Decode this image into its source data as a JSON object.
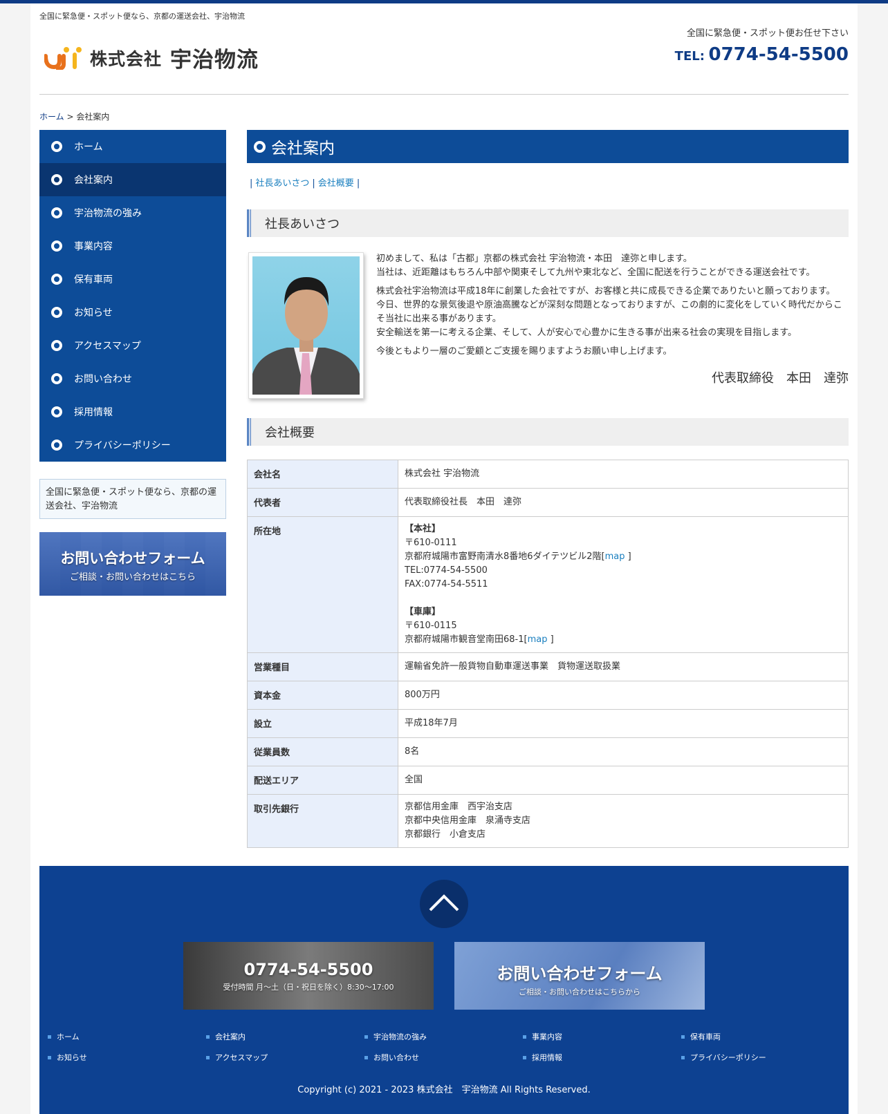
{
  "header": {
    "tagline": "全国に緊急便・スポット便なら、京都の運送会社、宇治物流",
    "logo_company_kind": "株式会社",
    "logo_company_name": "宇治物流",
    "right_tagline": "全国に緊急便・スポット便お任せ下さい",
    "tel_label": "TEL:",
    "tel_number": "0774-54-5500"
  },
  "breadcrumb": {
    "home": "ホーム",
    "sep": " > ",
    "current": "会社案内"
  },
  "sidebar": {
    "items": [
      {
        "label": "ホーム"
      },
      {
        "label": "会社案内",
        "active": true
      },
      {
        "label": "宇治物流の強み"
      },
      {
        "label": "事業内容"
      },
      {
        "label": "保有車両"
      },
      {
        "label": "お知らせ"
      },
      {
        "label": "アクセスマップ"
      },
      {
        "label": "お問い合わせ"
      },
      {
        "label": "採用情報"
      },
      {
        "label": "プライバシーポリシー"
      }
    ],
    "note": "全国に緊急便・スポット便なら、京都の運送会社、宇治物流",
    "banner_title": "お問い合わせフォーム",
    "banner_sub": "ご相談・お問い合わせはこちら"
  },
  "main": {
    "title": "会社案内",
    "anchors": [
      "社長あいさつ",
      "会社概要"
    ],
    "greeting_heading": "社長あいさつ",
    "greeting_paragraphs": [
      [
        "初めまして、私は「古都」京都の株式会社 宇治物流・本田　達弥と申します。",
        "当社は、近距離はもちろん中部や関東そして九州や東北など、全国に配送を行うことができる運送会社です。"
      ],
      [
        "株式会社宇治物流は平成18年に創業した会社ですが、お客様と共に成長できる企業でありたいと願っております。",
        "今日、世界的な景気後退や原油高騰などが深刻な問題となっておりますが、この劇的に変化をしていく時代だからこそ当社に出来る事があります。",
        "安全輸送を第一に考える企業、そして、人が安心で心豊かに生きる事が出来る社会の実現を目指します。"
      ],
      [
        "今後ともより一層のご愛顧とご支援を賜りますようお願い申し上げます。"
      ]
    ],
    "signature": "代表取締役　本田　達弥",
    "overview_heading": "会社概要",
    "table": {
      "company_name": {
        "label": "会社名",
        "value": "株式会社 宇治物流"
      },
      "representative": {
        "label": "代表者",
        "value": "代表取締役社長　本田　達弥"
      },
      "address": {
        "label": "所在地",
        "hq_title": "【本社】",
        "hq_zip": "〒610-0111",
        "hq_addr": "京都府城陽市富野南清水8番地6ダイテツビル2階[",
        "hq_tel": "TEL:0774-54-5500",
        "hq_fax": "FAX:0774-54-5511",
        "garage_title": "【車庫】",
        "garage_zip": "〒610-0115",
        "garage_addr": "京都府城陽市観音堂南田68-1[",
        "map_link": "map",
        "bracket_close": " ]"
      },
      "business": {
        "label": "営業種目",
        "value": "運輸省免許一般貨物自動車運送事業　貨物運送取扱業"
      },
      "capital": {
        "label": "資本金",
        "value": "800万円"
      },
      "founded": {
        "label": "設立",
        "value": "平成18年7月"
      },
      "employees": {
        "label": "従業員数",
        "value": "8名"
      },
      "area": {
        "label": "配送エリア",
        "value": "全国"
      },
      "banks": {
        "label": "取引先銀行",
        "values": [
          "京都信用金庫　西宇治支店",
          "京都中央信用金庫　泉涌寺支店",
          "京都銀行　小倉支店"
        ]
      }
    }
  },
  "footer": {
    "tel_number": "0774-54-5500",
    "tel_hours": "受付時間 月〜土（日・祝日を除く）8:30〜17:00",
    "form_title": "お問い合わせフォーム",
    "form_sub": "ご相談・お問い合わせはこちらから",
    "nav_row1": [
      "ホーム",
      "会社案内",
      "宇治物流の強み",
      "事業内容",
      "保有車両"
    ],
    "nav_row2": [
      "お知らせ",
      "アクセスマップ",
      "お問い合わせ",
      "採用情報",
      "プライバシーポリシー"
    ],
    "copyright": "Copyright (c) 2021 - 2023 株式会社　宇治物流 All Rights Reserved."
  },
  "colors": {
    "brand_blue": "#0d4c98",
    "dark_blue": "#0a3570",
    "footer_blue": "#0d4191",
    "link": "#1a7fbf"
  }
}
